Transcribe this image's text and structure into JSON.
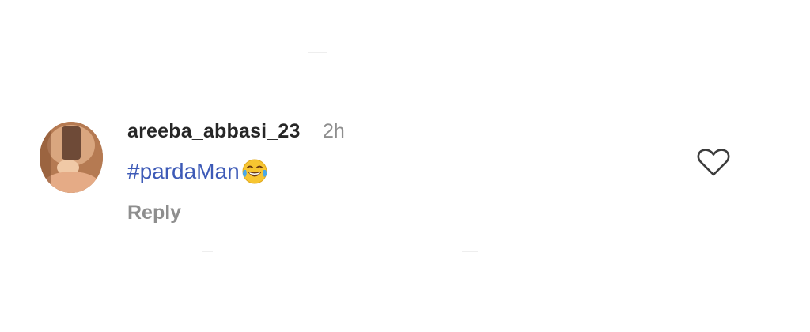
{
  "comment": {
    "username": "areeba_abbasi_23",
    "time_ago": "2h",
    "text": "#pardaMan",
    "emoji": "face-with-tears-of-joy",
    "reply_label": "Reply"
  },
  "icons": {
    "like": "heart-outline-icon"
  },
  "colors": {
    "username": "#262626",
    "muted": "#8e8e8e",
    "hashtag": "#3d5ab7",
    "background": "#ffffff"
  }
}
